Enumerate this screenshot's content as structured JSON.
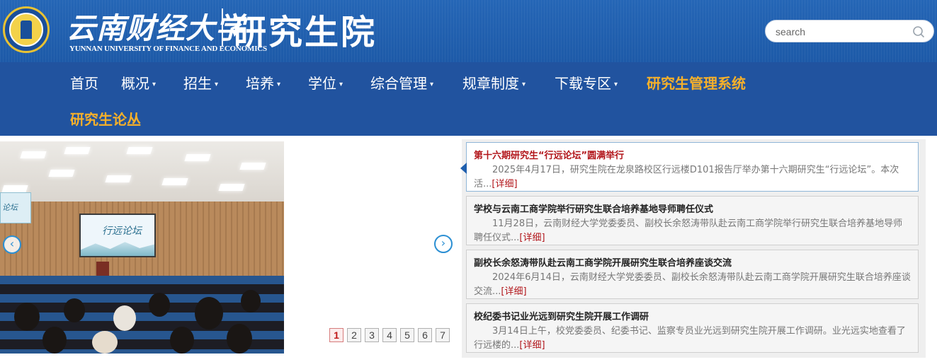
{
  "header": {
    "univ_name_cn": "云南财经大学",
    "univ_name_en": "YUNNAN UNIVERSITY OF FINANCE AND ECONOMICS",
    "school_name": "研究生院",
    "search_placeholder": "search"
  },
  "nav": {
    "items": [
      {
        "label": "首页",
        "has_caret": false
      },
      {
        "label": "概况",
        "has_caret": true
      },
      {
        "label": "招生",
        "has_caret": true
      },
      {
        "label": "培养",
        "has_caret": true
      },
      {
        "label": "学位",
        "has_caret": true
      },
      {
        "label": "综合管理",
        "has_caret": true
      },
      {
        "label": "规章制度",
        "has_caret": true
      },
      {
        "label": "下载专区",
        "has_caret": true
      },
      {
        "label": "研究生管理系统",
        "highlight": true
      },
      {
        "label": "研究生论丛",
        "highlight": true
      }
    ],
    "caret": "▾"
  },
  "slider": {
    "screen_text": "行远论坛",
    "banner_text": "论坛",
    "prev_icon": "‹",
    "next_icon": "›",
    "pages": [
      "1",
      "2",
      "3",
      "4",
      "5",
      "6",
      "7"
    ],
    "active_page": "1"
  },
  "news": [
    {
      "title": "第十六期研究生“行远论坛”圆满举行",
      "summary": "2025年4月17日，研究生院在龙泉路校区行远楼D101报告厅举办第十六期研究生“行远论坛”。本次活...",
      "more": "[详细]",
      "active": true
    },
    {
      "title": "学校与云南工商学院举行研究生联合培养基地导师聘任仪式",
      "summary": "11月28日，云南财经大学党委委员、副校长余怒涛带队赴云南工商学院举行研究生联合培养基地导师聘任仪式...",
      "more": "[详细]"
    },
    {
      "title": "副校长余怒涛带队赴云南工商学院开展研究生联合培养座谈交流",
      "summary": "2024年6月14日，云南财经大学党委委员、副校长余怒涛带队赴云南工商学院开展研究生联合培养座谈交流...",
      "more": "[详细]"
    },
    {
      "title": "校纪委书记业光远到研究生院开展工作调研",
      "summary": "3月14日上午，校党委委员、纪委书记、监察专员业光远到研究生院开展工作调研。业光远实地查看了行远楼的...",
      "more": "[详细]"
    }
  ],
  "colors": {
    "header_bg": "#1f5fae",
    "nav_bg": "#21539f",
    "nav_highlight": "#f6b02a",
    "news_active_title": "#b2161b",
    "pager_active": "#c01818"
  }
}
